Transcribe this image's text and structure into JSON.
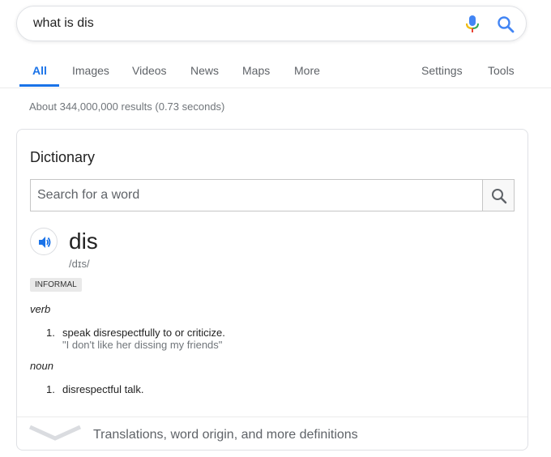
{
  "search": {
    "query": "what is dis",
    "mic_icon": "mic-icon",
    "search_icon": "search-icon"
  },
  "tabs": {
    "items": [
      {
        "label": "All",
        "active": true
      },
      {
        "label": "Images"
      },
      {
        "label": "Videos"
      },
      {
        "label": "News"
      },
      {
        "label": "Maps"
      },
      {
        "label": "More"
      }
    ],
    "right": [
      {
        "label": "Settings"
      },
      {
        "label": "Tools"
      }
    ]
  },
  "result_stats": "About 344,000,000 results (0.73 seconds)",
  "dictionary": {
    "title": "Dictionary",
    "search_placeholder": "Search for a word",
    "word": "dis",
    "phonetic": "/dɪs/",
    "label": "INFORMAL",
    "entries": [
      {
        "pos": "verb",
        "definitions": [
          {
            "num": "1.",
            "text": "speak disrespectfully to or criticize.",
            "example": "\"I don't like her dissing my friends\""
          }
        ]
      },
      {
        "pos": "noun",
        "definitions": [
          {
            "num": "1.",
            "text": "disrespectful talk."
          }
        ]
      }
    ],
    "footer": "Translations, word origin, and more definitions"
  },
  "colors": {
    "accent": "#1a73e8",
    "muted": "#70757a",
    "text": "#222222"
  }
}
